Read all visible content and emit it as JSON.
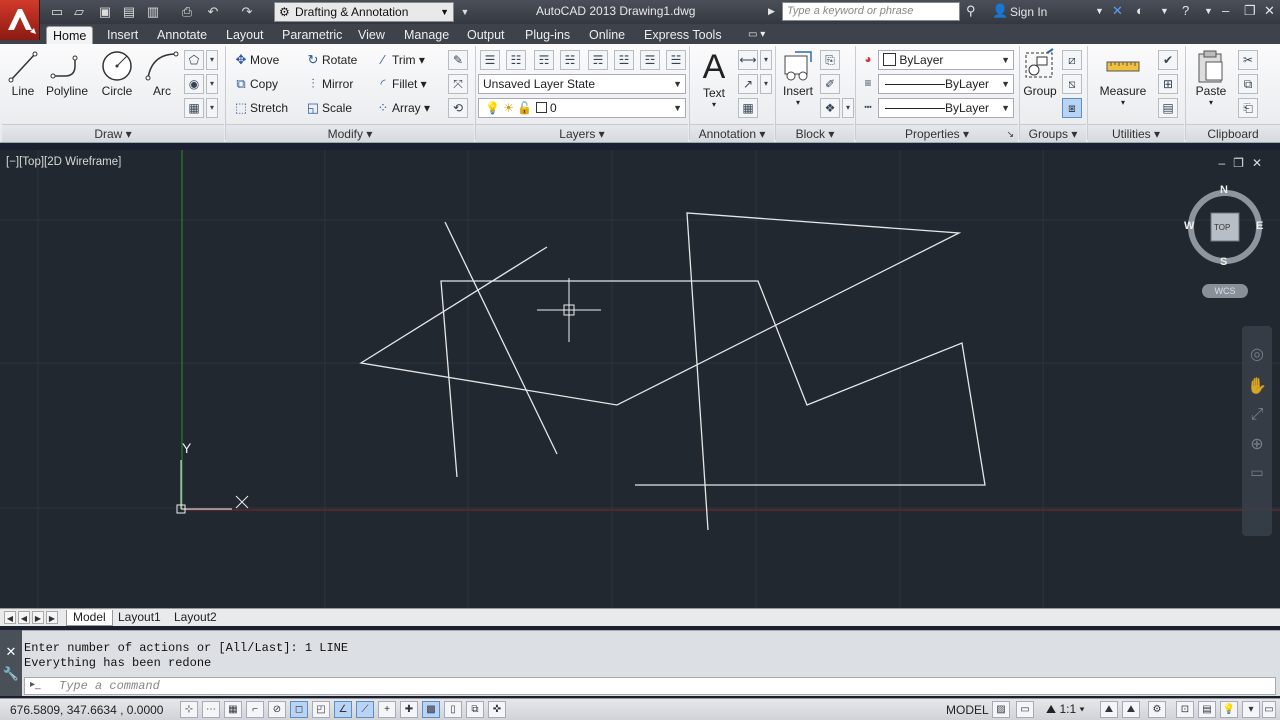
{
  "titlebar": {
    "workspace": "Drafting & Annotation",
    "title": "AutoCAD 2013    Drawing1.dwg",
    "search_placeholder": "Type a keyword or phrase",
    "signin": "Sign In"
  },
  "tabs": [
    "Home",
    "Insert",
    "Annotate",
    "Layout",
    "Parametric",
    "View",
    "Manage",
    "Output",
    "Plug-ins",
    "Online",
    "Express Tools"
  ],
  "ribbon": {
    "draw": {
      "title": "Draw",
      "line": "Line",
      "polyline": "Polyline",
      "circle": "Circle",
      "arc": "Arc"
    },
    "modify": {
      "title": "Modify",
      "move": "Move",
      "rotate": "Rotate",
      "trim": "Trim",
      "copy": "Copy",
      "mirror": "Mirror",
      "fillet": "Fillet",
      "stretch": "Stretch",
      "scale": "Scale",
      "array": "Array"
    },
    "layers": {
      "title": "Layers",
      "state": "Unsaved Layer State",
      "current": "0"
    },
    "annotation": {
      "title": "Annotation",
      "text": "Text"
    },
    "block": {
      "title": "Block",
      "insert": "Insert"
    },
    "properties": {
      "title": "Properties",
      "color": "ByLayer",
      "linetype": "ByLayer",
      "lineweight": "ByLayer"
    },
    "groups": {
      "title": "Groups",
      "group": "Group"
    },
    "utilities": {
      "title": "Utilities",
      "measure": "Measure"
    },
    "clipboard": {
      "title": "Clipboard",
      "paste": "Paste"
    }
  },
  "viewport": {
    "label": "[−][Top][2D Wireframe]",
    "viewcube": {
      "n": "N",
      "s": "S",
      "e": "E",
      "w": "W",
      "face": "TOP"
    },
    "wcs": "WCS",
    "ucs_x": "X",
    "ucs_y": "Y"
  },
  "layout_tabs": [
    "Model",
    "Layout1",
    "Layout2"
  ],
  "command": {
    "history": [
      "Enter number of actions or [All/Last]: 1 LINE",
      "Everything has been redone"
    ],
    "placeholder": "Type a command"
  },
  "status": {
    "coords": "676.5809, 347.6634 , 0.0000",
    "model": "MODEL",
    "scale": "1:1"
  }
}
